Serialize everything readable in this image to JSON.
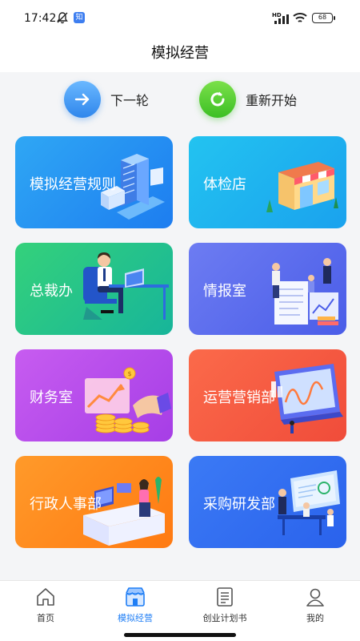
{
  "status": {
    "time": "17:42",
    "app_badge": "知",
    "hd": "HD",
    "battery": "68"
  },
  "header": {
    "title": "模拟经营"
  },
  "actions": {
    "next_label": "下一轮",
    "restart_label": "重新开始"
  },
  "cards": [
    {
      "label": "模拟经营规则"
    },
    {
      "label": "体检店"
    },
    {
      "label": "总裁办"
    },
    {
      "label": "情报室"
    },
    {
      "label": "财务室"
    },
    {
      "label": "运营营销部"
    },
    {
      "label": "行政人事部"
    },
    {
      "label": "采购研发部"
    }
  ],
  "tabbar": {
    "items": [
      {
        "label": "首页",
        "icon": "home-icon"
      },
      {
        "label": "模拟经营",
        "icon": "store-icon",
        "active": true
      },
      {
        "label": "创业计划书",
        "icon": "document-icon"
      },
      {
        "label": "我的",
        "icon": "user-icon"
      }
    ]
  },
  "colors": {
    "accent": "#1f7ef5",
    "next": "#2f86ec",
    "restart": "#3cbf24"
  }
}
